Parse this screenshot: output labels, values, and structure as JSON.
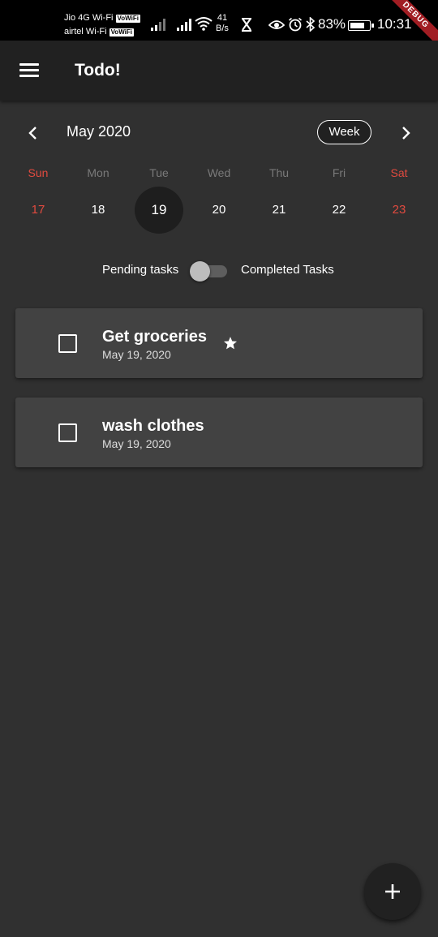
{
  "status_bar": {
    "carrier_1": "Jio 4G Wi-Fi",
    "carrier_2": "airtel Wi-Fi",
    "vowifi_badge": "VoWiFi",
    "net_speed_value": "41",
    "net_speed_unit": "B/s",
    "battery_percent": "83%",
    "battery_level": 0.83,
    "time": "10:31",
    "debug_banner": "DEBUG",
    "icons": [
      "signal-icon",
      "signal-icon",
      "wifi-icon",
      "hourglass-icon",
      "eye-icon",
      "alarm-icon",
      "bluetooth-icon",
      "battery-icon"
    ]
  },
  "app_bar": {
    "title": "Todo!",
    "menu_icon": "menu-icon"
  },
  "calendar": {
    "month_label": "May 2020",
    "format_button": "Week",
    "prev_icon": "chevron-left-icon",
    "next_icon": "chevron-right-icon",
    "days": [
      {
        "weekday": "Sun",
        "date": "17",
        "weekend": true,
        "selected": false
      },
      {
        "weekday": "Mon",
        "date": "18",
        "weekend": false,
        "selected": false
      },
      {
        "weekday": "Tue",
        "date": "19",
        "weekend": false,
        "selected": true
      },
      {
        "weekday": "Wed",
        "date": "20",
        "weekend": false,
        "selected": false
      },
      {
        "weekday": "Thu",
        "date": "21",
        "weekend": false,
        "selected": false
      },
      {
        "weekday": "Fri",
        "date": "22",
        "weekend": false,
        "selected": false
      },
      {
        "weekday": "Sat",
        "date": "23",
        "weekend": true,
        "selected": false
      }
    ]
  },
  "toggle": {
    "left_label": "Pending tasks",
    "right_label": "Completed Tasks",
    "checked": false
  },
  "tasks": [
    {
      "title": "Get groceries",
      "date": "May 19, 2020",
      "starred": true,
      "completed": false
    },
    {
      "title": "wash clothes",
      "date": "May 19, 2020",
      "starred": false,
      "completed": false
    }
  ],
  "fab": {
    "icon": "plus-icon"
  },
  "colors": {
    "background": "#303030",
    "app_bar": "#212121",
    "card": "#424242",
    "weekend": "#e04a3f",
    "weekday_muted": "#7a7a7a"
  }
}
